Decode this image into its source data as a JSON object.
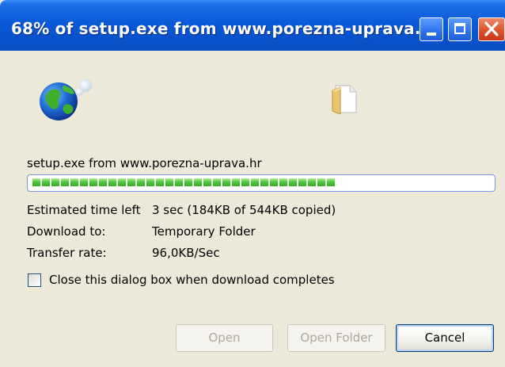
{
  "window": {
    "title": "68% of setup.exe from www.porezna-uprava...",
    "controls": [
      "minimize-icon",
      "maximize-icon",
      "close-icon"
    ]
  },
  "icons": {
    "source": "globe-icon",
    "destination": "folder-icon"
  },
  "download": {
    "filename_line": "setup.exe from www.porezna-uprava.hr",
    "progress_percent": 68
  },
  "details": {
    "time_left_label": "Estimated time left",
    "time_left_value": "3 sec (184KB of 544KB copied)",
    "download_to_label": "Download to:",
    "download_to_value": "Temporary Folder",
    "transfer_rate_label": "Transfer rate:",
    "transfer_rate_value": "96,0KB/Sec"
  },
  "options": {
    "close_on_complete_label": "Close this dialog box when download completes",
    "close_on_complete_checked": false
  },
  "buttons": {
    "open": "Open",
    "open_folder": "Open Folder",
    "cancel": "Cancel"
  },
  "colors": {
    "title_bar": "#0a5ad8",
    "progress": "#34b020",
    "dialog_bg": "#ece9d8"
  }
}
